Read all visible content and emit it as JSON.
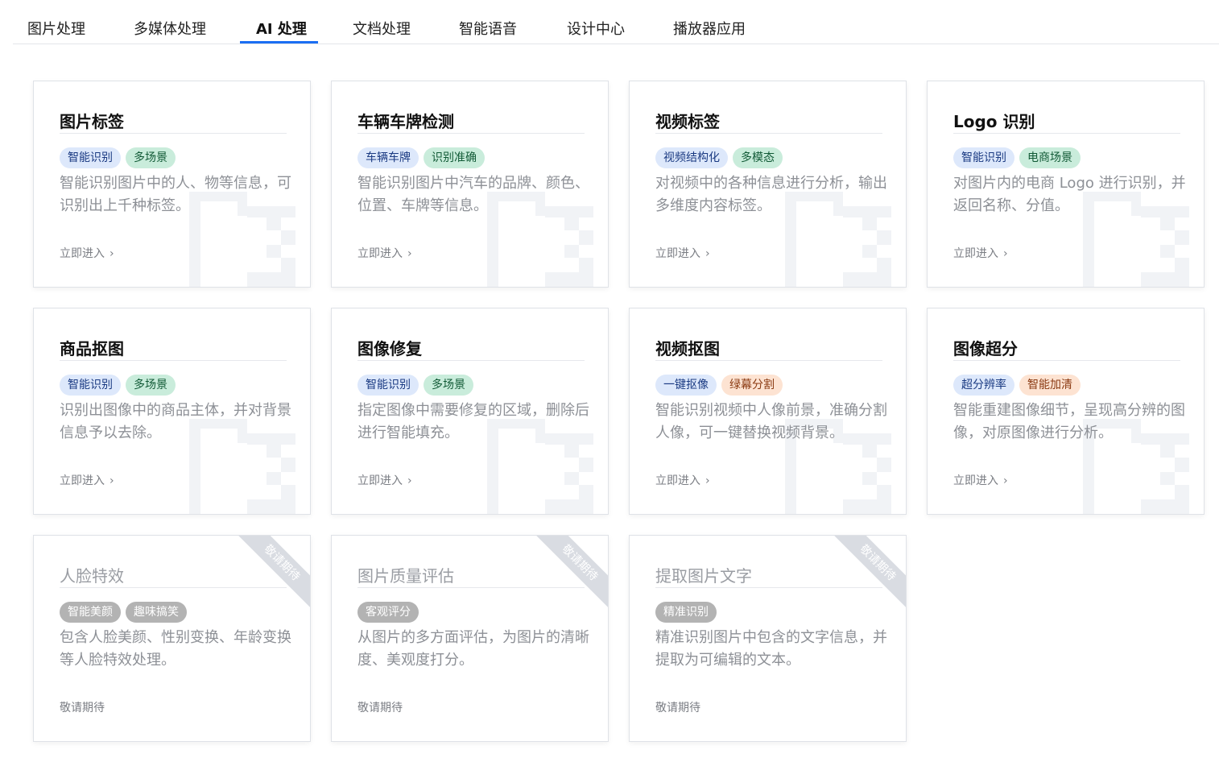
{
  "tabs": [
    {
      "label": "图片处理"
    },
    {
      "label": "多媒体处理"
    },
    {
      "label": "AI 处理"
    },
    {
      "label": "文档处理"
    },
    {
      "label": "智能语音"
    },
    {
      "label": "设计中心"
    },
    {
      "label": "播放器应用"
    }
  ],
  "active_tab": "AI 处理",
  "colors": {
    "accent": "#1b6ef3",
    "tag_blue": "#dde8fb",
    "tag_green": "#c9ecdb",
    "tag_orange": "#fde3d2",
    "tag_grey": "#b3b3b3"
  },
  "cards": [
    {
      "title": "图片标签",
      "tags": [
        {
          "text": "智能识别",
          "color": "blue"
        },
        {
          "text": "多场景",
          "color": "green"
        }
      ],
      "desc": "智能识别图片中的人、物等信息，可识别出上千种标签。",
      "link": "立即进入",
      "disabled": false
    },
    {
      "title": "车辆车牌检测",
      "tags": [
        {
          "text": "车辆车牌",
          "color": "blue"
        },
        {
          "text": "识别准确",
          "color": "green"
        }
      ],
      "desc": "智能识别图片中汽车的品牌、颜色、位置、车牌等信息。",
      "link": "立即进入",
      "disabled": false
    },
    {
      "title": "视频标签",
      "tags": [
        {
          "text": "视频结构化",
          "color": "blue"
        },
        {
          "text": "多模态",
          "color": "green"
        }
      ],
      "desc": "对视频中的各种信息进行分析，输出多维度内容标签。",
      "link": "立即进入",
      "disabled": false
    },
    {
      "title": "Logo 识别",
      "tags": [
        {
          "text": "智能识别",
          "color": "blue"
        },
        {
          "text": "电商场景",
          "color": "green"
        }
      ],
      "desc": "对图片内的电商 Logo 进行识别，并返回名称、分值。",
      "link": "立即进入",
      "disabled": false
    },
    {
      "title": "商品抠图",
      "tags": [
        {
          "text": "智能识别",
          "color": "blue"
        },
        {
          "text": "多场景",
          "color": "green"
        }
      ],
      "desc": "识别出图像中的商品主体，并对背景信息予以去除。",
      "link": "立即进入",
      "disabled": false
    },
    {
      "title": "图像修复",
      "tags": [
        {
          "text": "智能识别",
          "color": "blue"
        },
        {
          "text": "多场景",
          "color": "green"
        }
      ],
      "desc": "指定图像中需要修复的区域，删除后进行智能填充。",
      "link": "立即进入",
      "disabled": false
    },
    {
      "title": "视频抠图",
      "tags": [
        {
          "text": "一键抠像",
          "color": "blue"
        },
        {
          "text": "绿幕分割",
          "color": "orange"
        }
      ],
      "desc": "智能识别视频中人像前景，准确分割人像，可一键替换视频背景。",
      "link": "立即进入",
      "disabled": false
    },
    {
      "title": "图像超分",
      "tags": [
        {
          "text": "超分辨率",
          "color": "blue"
        },
        {
          "text": "智能加清",
          "color": "orange"
        }
      ],
      "desc": "智能重建图像细节，呈现高分辨的图像，对原图像进行分析。",
      "link": "立即进入",
      "disabled": false
    },
    {
      "title": "人脸特效",
      "tags": [
        {
          "text": "智能美颜",
          "color": "grey"
        },
        {
          "text": "趣味搞笑",
          "color": "grey"
        }
      ],
      "desc": "包含人脸美颜、性别变换、年龄变换等人脸特效处理。",
      "link": "敬请期待",
      "ribbon": "敬请期待",
      "disabled": true
    },
    {
      "title": "图片质量评估",
      "tags": [
        {
          "text": "客观评分",
          "color": "grey"
        }
      ],
      "desc": "从图片的多方面评估，为图片的清晰度、美观度打分。",
      "link": "敬请期待",
      "ribbon": "敬请期待",
      "disabled": true
    },
    {
      "title": "提取图片文字",
      "tags": [
        {
          "text": "精准识别",
          "color": "grey"
        }
      ],
      "desc": "精准识别图片中包含的文字信息，并提取为可编辑的文本。",
      "link": "敬请期待",
      "ribbon": "敬请期待",
      "disabled": true
    }
  ]
}
